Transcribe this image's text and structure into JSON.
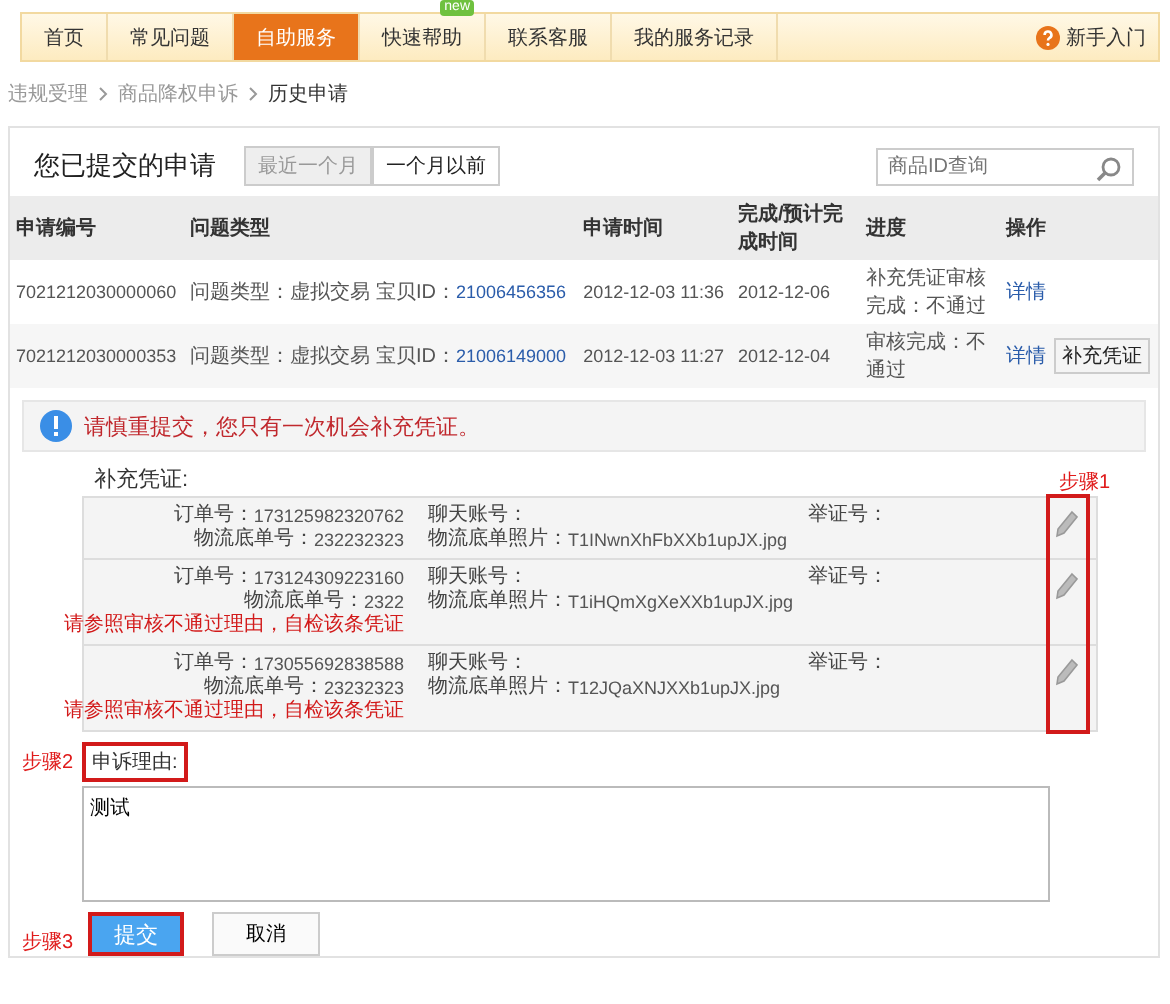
{
  "nav": {
    "tabs": [
      {
        "label": "首页",
        "selected": false
      },
      {
        "label": "常见问题",
        "selected": false
      },
      {
        "label": "自助服务",
        "selected": true
      },
      {
        "label": "快速帮助",
        "selected": false,
        "badge": "new"
      },
      {
        "label": "联系客服",
        "selected": false
      },
      {
        "label": "我的服务记录",
        "selected": false
      }
    ],
    "help_link": "新手入门"
  },
  "breadcrumb": [
    "违规受理",
    "商品降权申诉",
    "历史申请"
  ],
  "panel": {
    "title": "您已提交的申请",
    "filters": [
      {
        "label": "最近一个月",
        "selected": false
      },
      {
        "label": "一个月以前",
        "selected": true
      }
    ],
    "search": {
      "placeholder": "商品ID查询"
    }
  },
  "table": {
    "columns": [
      "申请编号",
      "问题类型",
      "申请时间",
      "完成/预计完成时间",
      "进度",
      "操作"
    ],
    "rows": [
      {
        "id": "7021212030000060",
        "type": "问题类型：虚拟交易 宝贝ID：",
        "item_id": "21006456356",
        "time": "2012-12-03 11:36",
        "done": "2012-12-06",
        "progress": "补充凭证审核完成：不通过",
        "detail": "详情"
      },
      {
        "id": "7021212030000353",
        "type": "问题类型：虚拟交易 宝贝ID：",
        "item_id": "21006149000",
        "time": "2012-12-03 11:27",
        "done": "2012-12-04",
        "progress": "审核完成：不通过",
        "detail": "详情",
        "button": "补充凭证"
      }
    ]
  },
  "notice": "请慎重提交，您只有一次机会补充凭证。",
  "evidence": {
    "label": "补充凭证:",
    "step": "步骤1",
    "items": [
      {
        "columns": [
          [
            {
              "label": "订单号：",
              "value": "173125982320762"
            },
            {
              "label": "物流底单号：",
              "value": "232232323"
            }
          ],
          [
            {
              "label": "聊天账号："
            },
            {
              "label": "物流底单照片：",
              "value": "T1INwnXhFbXXb1upJX.jpg"
            }
          ],
          [
            {
              "label": "举证号："
            }
          ]
        ]
      },
      {
        "columns": [
          [
            {
              "label": "订单号：",
              "value": "173124309223160"
            },
            {
              "label": "物流底单号：",
              "value": "2322"
            }
          ],
          [
            {
              "label": "聊天账号："
            },
            {
              "label": "物流底单照片：",
              "value": "T1iHQmXgXeXXb1upJX.jpg"
            }
          ],
          [
            {
              "label": "举证号："
            }
          ]
        ],
        "warning": "请参照审核不通过理由，自检该条凭证"
      },
      {
        "columns": [
          [
            {
              "label": "订单号：",
              "value": "173055692838588"
            },
            {
              "label": "物流底单号：",
              "value": "23232323"
            }
          ],
          [
            {
              "label": "聊天账号："
            },
            {
              "label": "物流底单照片：",
              "value": "T12JQaXNJXXb1upJX.jpg"
            }
          ],
          [
            {
              "label": "举证号："
            }
          ]
        ],
        "warning": "请参照审核不通过理由，自检该条凭证"
      }
    ]
  },
  "reason": {
    "step": "步骤2",
    "label": "申诉理由:",
    "value": "测试"
  },
  "actions": {
    "step": "步骤3",
    "submit": "提交",
    "cancel": "取消"
  }
}
